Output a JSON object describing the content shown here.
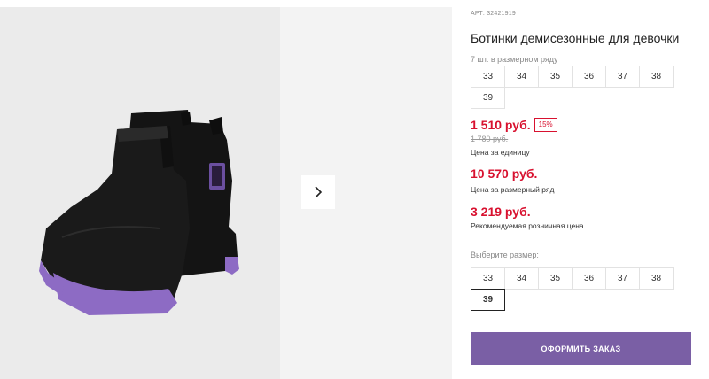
{
  "product": {
    "article": "АРТ: 32421919",
    "title": "Ботинки демисезонные для девочки",
    "row_note": "7 шт. в размерном ряду",
    "row_sizes": [
      "33",
      "34",
      "35",
      "36",
      "37",
      "38",
      "39"
    ]
  },
  "prices": {
    "unit_price": "1 510 руб.",
    "discount": "15%",
    "old_price": "1 780 руб.",
    "unit_caption": "Цена за единицу",
    "row_price": "10 570 руб.",
    "row_caption": "Цена за размерный ряд",
    "retail_price": "3 219 руб.",
    "retail_caption": "Рекомендуемая розничная цена"
  },
  "size_picker": {
    "label": "Выберите размер:",
    "sizes": [
      "33",
      "34",
      "35",
      "36",
      "37",
      "38",
      "39"
    ],
    "selected": "39"
  },
  "order_button": "ОФОРМИТЬ ЗАКАЗ",
  "colors": {
    "accent": "#7a5fa5",
    "price_red": "#d8112f",
    "sole_purple": "#8d6bc4"
  },
  "icons": {
    "next": "chevron-right-icon"
  }
}
